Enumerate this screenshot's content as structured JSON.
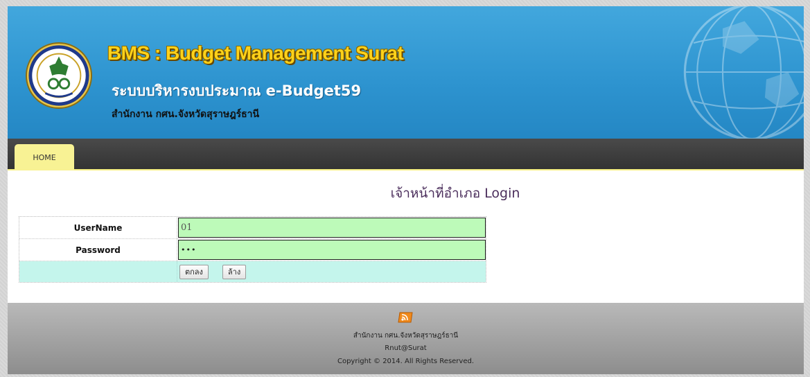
{
  "header": {
    "title_en": "BMS : Budget Management Surat",
    "title_th": "ระบบบริหารงบประมาณ e-Budget59",
    "office": "สำนักงาน กศน.จังหวัดสุราษฎร์ธานี",
    "logo_icon": "seal-emblem-icon",
    "decoration_icon": "globe-icon",
    "colors": {
      "header_bg": "#2d93cf",
      "title_en": "#ffd21a",
      "nav_bg": "#333333",
      "nav_active": "#f8f294"
    }
  },
  "nav": {
    "items": [
      {
        "label": "HOME",
        "active": true
      }
    ]
  },
  "login": {
    "title": "เจ้าหน้าที่อำเภอ Login",
    "username_label": "UserName",
    "username_value": "01",
    "password_label": "Password",
    "password_value": "•••",
    "submit_label": "ตกลง",
    "reset_label": "ล้าง",
    "colors": {
      "input_bg": "#bdfab9",
      "action_row_bg": "#c4f5ec",
      "title": "#4b2e5c"
    }
  },
  "footer": {
    "icon": "rss-feed-icon",
    "office": "สำนักงาน กศน.จังหวัดสุราษฎร์ธานี",
    "author": "Rnut@Surat",
    "copyright": "Copyright © 2014. All Rights Reserved."
  }
}
